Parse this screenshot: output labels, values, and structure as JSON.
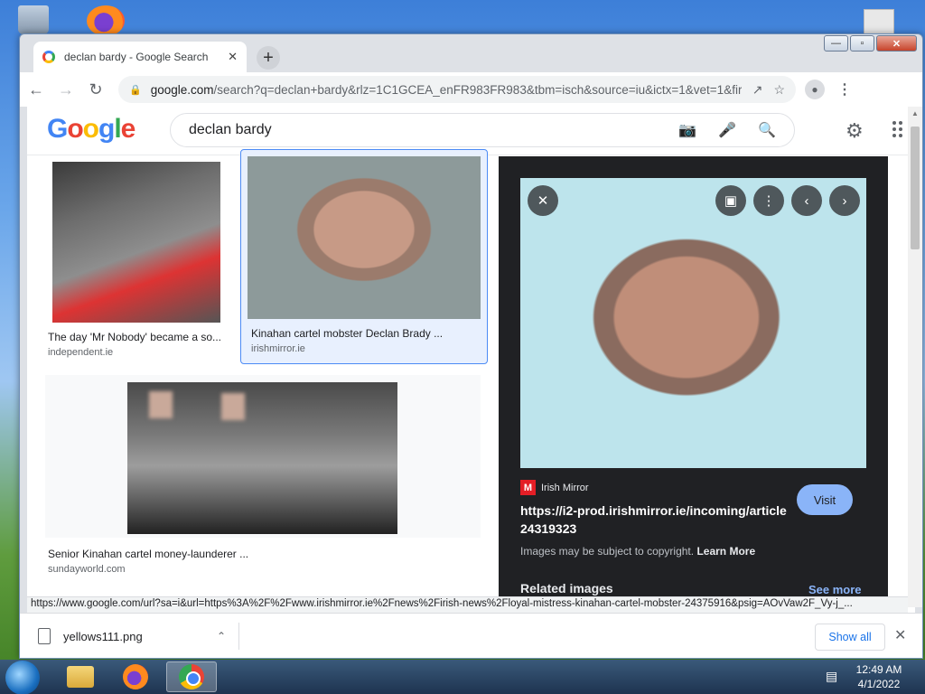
{
  "browser": {
    "tab_title": "declan bardy - Google Search",
    "tab_close": "✕",
    "new_tab": "+",
    "url_host": "google.com",
    "url_rest": "/search?q=declan+bardy&rlz=1C1GCEA_enFR983FR983&tbm=isch&source=iu&ictx=1&vet=1&fir=...",
    "window_controls": {
      "minimize": "—",
      "maximize": "▫",
      "close": "✕"
    }
  },
  "google": {
    "logo": [
      "G",
      "o",
      "o",
      "g",
      "l",
      "e"
    ],
    "query": "declan bardy"
  },
  "results": [
    {
      "caption": "The day 'Mr Nobody' became a so...",
      "source": "independent.ie"
    },
    {
      "caption": "Kinahan cartel mobster Declan Brady ...",
      "source": "irishmirror.ie"
    },
    {
      "caption": "Senior Kinahan cartel money-launderer ...",
      "source": "sundayworld.com"
    }
  ],
  "detail": {
    "publisher_logo": "M",
    "publisher": "Irish Mirror",
    "title": "https://i2-prod.irishmirror.ie/incoming/article24319323",
    "visit_label": "Visit",
    "copyright": "Images may be subject to copyright.",
    "learn_more": "Learn More",
    "related_heading": "Related images",
    "see_more": "See more"
  },
  "status_url": "https://www.google.com/url?sa=i&url=https%3A%2F%2Fwww.irishmirror.ie%2Fnews%2Firish-news%2Floyal-mistress-kinahan-cartel-mobster-24375916&psig=AOvVaw2F_Vy-j_...",
  "downloads": {
    "file_name": "yellows111.png",
    "show_all": "Show all"
  },
  "taskbar": {
    "time": "12:49 AM",
    "date": "4/1/2022"
  },
  "colors": {
    "selected_border": "#4c8bf5",
    "visit_button": "#8ab4f8",
    "detail_panel": "#202124",
    "mirror_red": "#e41e26"
  }
}
